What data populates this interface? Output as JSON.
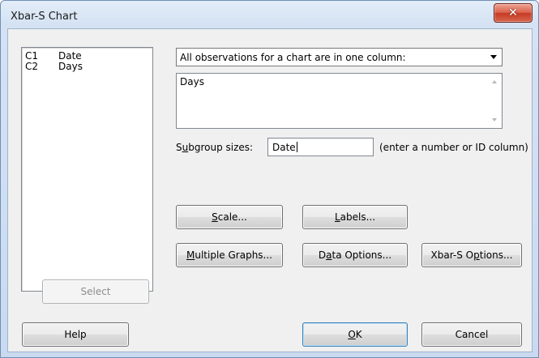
{
  "window": {
    "title": "Xbar-S Chart"
  },
  "variables": [
    {
      "col": "C1",
      "name": "Date"
    },
    {
      "col": "C2",
      "name": "Days"
    }
  ],
  "data_layout": {
    "selected": "All observations for a chart are in one column:"
  },
  "columns_box": {
    "value": "Days"
  },
  "subgroup": {
    "label_pre": "S",
    "label_ul": "u",
    "label_post": "bgroup sizes:",
    "value": "Date",
    "hint": "(enter a number or ID column)"
  },
  "buttons": {
    "scale": {
      "pre": "",
      "ul": "S",
      "post": "cale..."
    },
    "labels": {
      "pre": "",
      "ul": "L",
      "post": "abels..."
    },
    "multiple": {
      "pre": "",
      "ul": "M",
      "post": "ultiple Graphs..."
    },
    "data": {
      "pre": "D",
      "ul": "a",
      "post": "ta Options..."
    },
    "xbar_s": {
      "pre": "Xbar-S O",
      "ul": "p",
      "post": "tions..."
    },
    "select": {
      "label": "Select"
    },
    "help": {
      "label": "Help"
    },
    "ok": {
      "pre": "",
      "ul": "O",
      "post": "K"
    },
    "cancel": {
      "label": "Cancel"
    }
  }
}
